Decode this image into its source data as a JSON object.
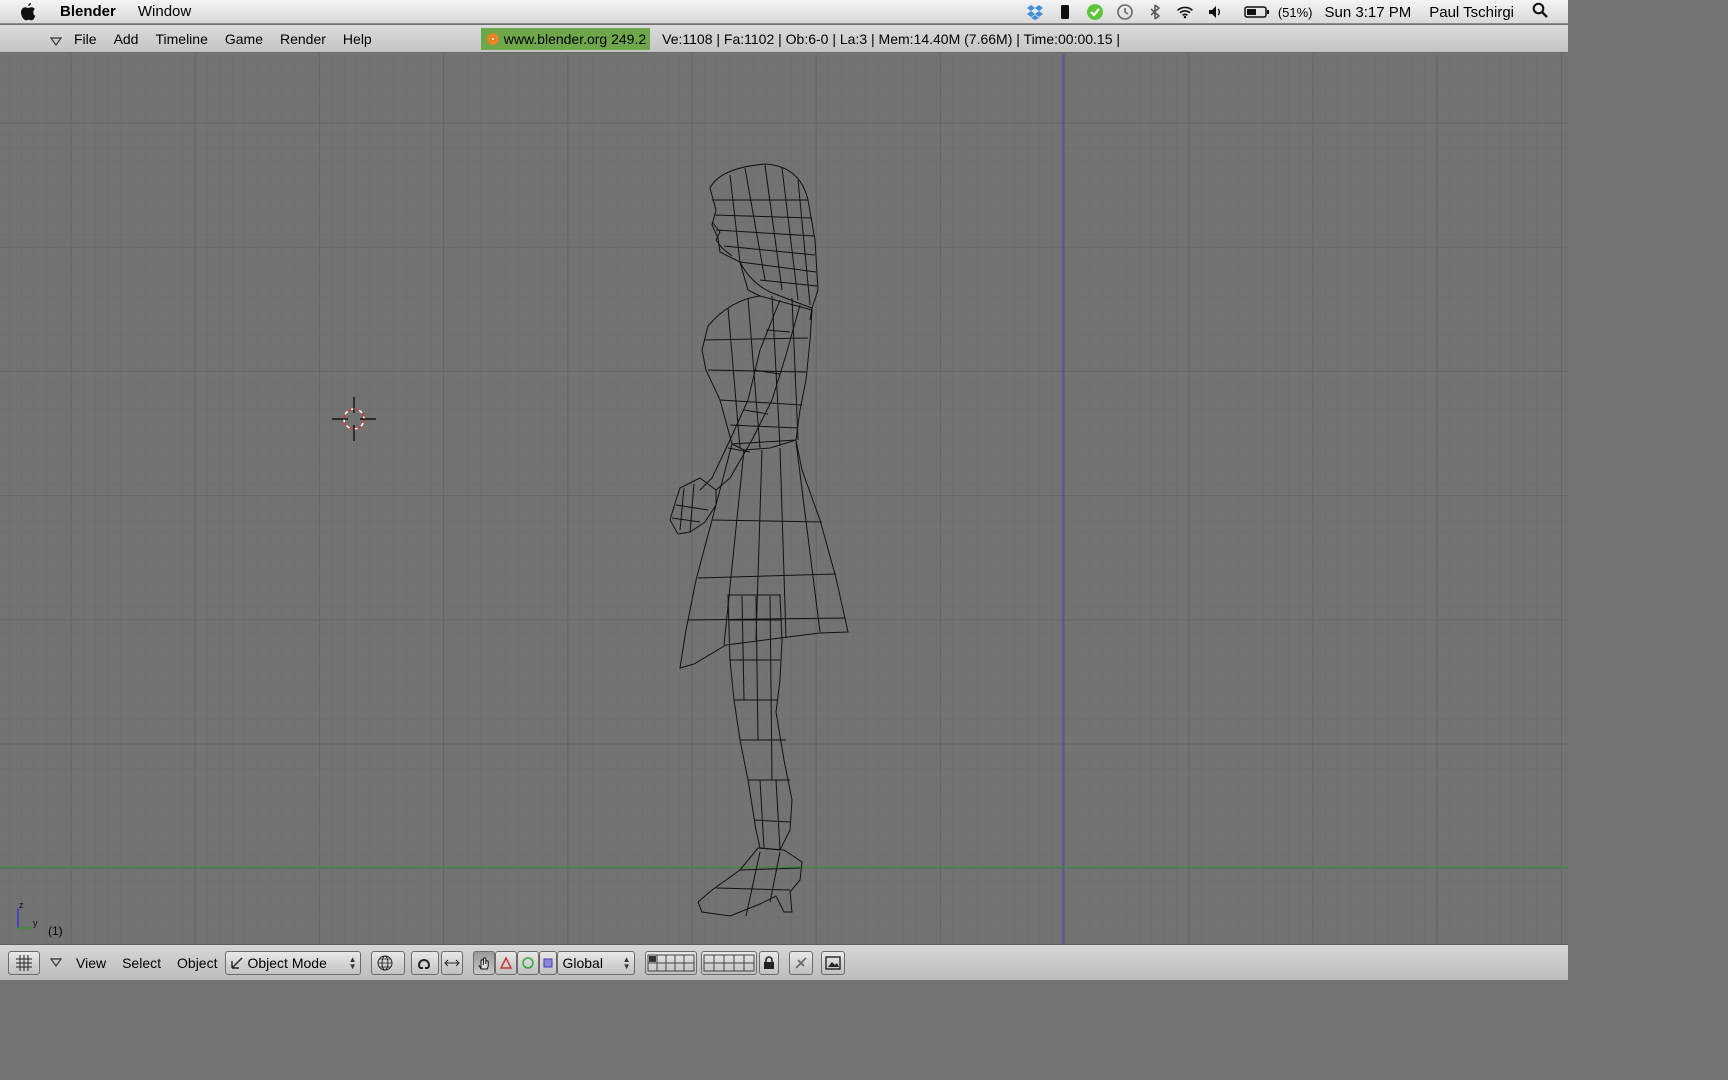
{
  "macbar": {
    "app_name": "Blender",
    "menu": [
      "Window"
    ],
    "battery_pct": "(51%)",
    "clock": "Sun 3:17 PM",
    "user": "Paul Tschirgi"
  },
  "infobar": {
    "menus": [
      "File",
      "Add",
      "Timeline",
      "Game",
      "Render",
      "Help"
    ],
    "version_badge": "www.blender.org 249.2",
    "stats": "Ve:1108 | Fa:1102 | Ob:6-0 | La:3  | Mem:14.40M (7.66M)  | Time:00:00.15 |"
  },
  "viewport": {
    "frame": "(1)",
    "colors": {
      "background": "#737373",
      "grid": "#666666",
      "x_axis": "#3f8f3f",
      "z_axis": "#4b4bb3",
      "wire": "#111111"
    }
  },
  "viewheader": {
    "menus": [
      "View",
      "Select",
      "Object"
    ],
    "mode": "Object Mode",
    "orientation": "Global",
    "icons": [
      "grid-icon",
      "draw-type-icon",
      "pivot-icon",
      "manipulator-icon",
      "translate-icon",
      "rotate-icon",
      "scale-icon",
      "layers-icon",
      "lock-icon",
      "render-icon"
    ]
  }
}
